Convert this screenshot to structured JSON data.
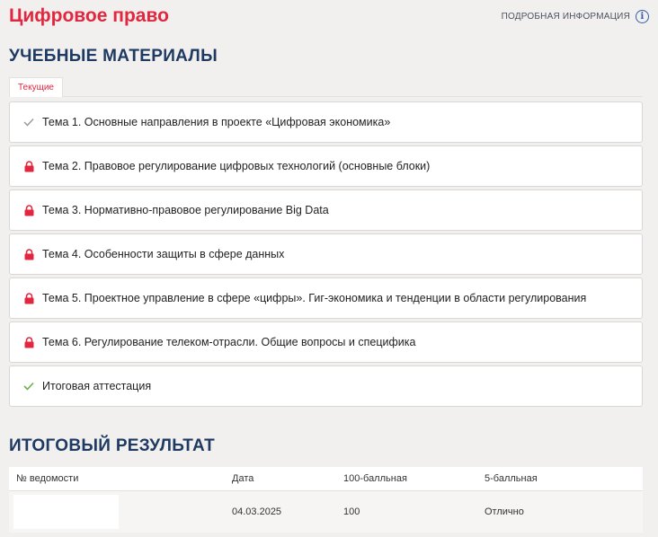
{
  "header": {
    "title": "Цифровое право",
    "more_info": "ПОДРОБНАЯ ИНФОРМАЦИЯ"
  },
  "materials": {
    "title": "УЧЕБНЫЕ МАТЕРИАЛЫ",
    "tab_current": "Текущие",
    "topics": [
      {
        "label": "Тема 1. Основные направления в проекте «Цифровая экономика»",
        "status": "completed"
      },
      {
        "label": "Тема 2. Правовое регулирование цифровых технологий (основные блоки)",
        "status": "locked"
      },
      {
        "label": "Тема 3. Нормативно-правовое регулирование Big Data",
        "status": "locked"
      },
      {
        "label": "Тема 4. Особенности защиты в сфере данных",
        "status": "locked"
      },
      {
        "label": "Тема 5. Проектное управление в сфере «цифры». Гиг-экономика и тенденции в области регулирования",
        "status": "locked"
      },
      {
        "label": "Тема 6. Регулирование телеком-отрасли. Общие вопросы и специфика",
        "status": "locked"
      },
      {
        "label": "Итоговая аттестация",
        "status": "passed"
      }
    ]
  },
  "result": {
    "title": "ИТОГОВЫЙ РЕЗУЛЬТАТ",
    "columns": [
      "№ ведомости",
      "Дата",
      "100-балльная",
      "5-балльная"
    ],
    "rows": [
      {
        "statement": "",
        "date": "04.03.2025",
        "score100": "100",
        "score5": "Отлично"
      }
    ]
  },
  "colors": {
    "accent": "#e3263f",
    "heading": "#1e3a63",
    "check_completed": "#9a9a9a",
    "check_passed": "#6ab04c",
    "lock": "#e3263f"
  }
}
